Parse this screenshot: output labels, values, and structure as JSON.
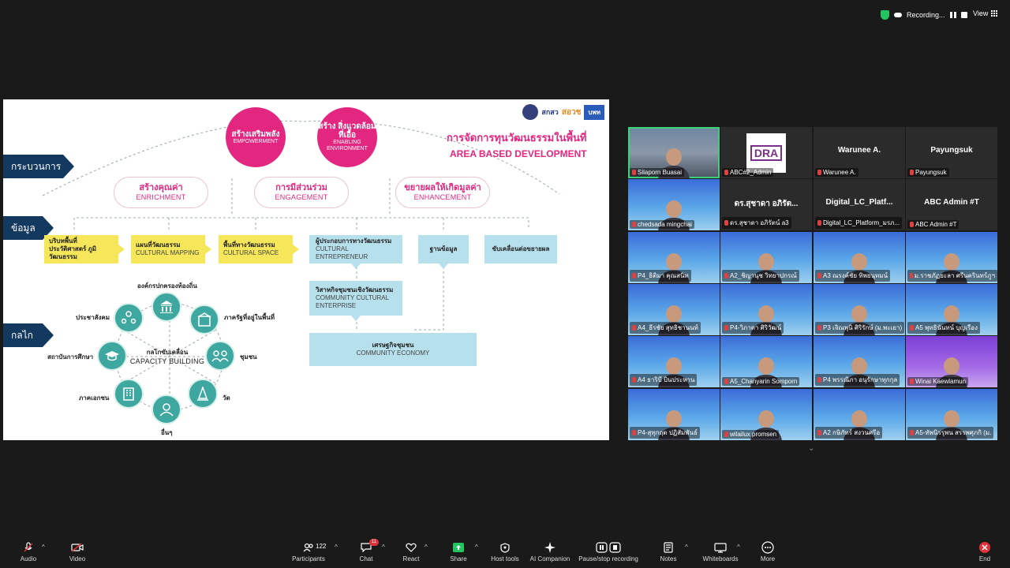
{
  "status_bar": {
    "recording_label": "Recording...",
    "view_label": "View"
  },
  "slide": {
    "title_th": "การจัดการทุนวัฒนธรรมในพื้นที่",
    "title_en": "AREA BASED DEVELOPMENT",
    "logo_texts": {
      "t": "สกสว",
      "s": "สอวช",
      "b": "บพท"
    },
    "circles": [
      {
        "th": "สร้างเสริมพลัง",
        "en": "EMPOWERMENT"
      },
      {
        "th": "สร้าง สิ่งแวดล้อมที่เอื้อ",
        "en": "ENABLING ENVIRONMENT"
      }
    ],
    "side_labels": {
      "process": "กระบวนการ",
      "data": "ข้อมูล",
      "mechanism": "กลไก"
    },
    "pills": [
      {
        "th": "สร้างคุณค่า",
        "en": "ENRICHMENT"
      },
      {
        "th": "การมีส่วนร่วม",
        "en": "ENGAGEMENT"
      },
      {
        "th": "ขยายผลให้เกิดมูลค่า",
        "en": "ENHANCEMENT"
      }
    ],
    "yellow_boxes": [
      {
        "th": "บริบทพื้นที่ประวัติศาสตร์ ภูมิวัฒนธรรม",
        "en": ""
      },
      {
        "th": "แผนที่วัฒนธรรม",
        "en": "CULTURAL MAPPING"
      },
      {
        "th": "พื้นที่ทางวัฒนธรรม",
        "en": "CULTURAL SPACE"
      }
    ],
    "blue_boxes": {
      "entrepreneur": {
        "th": "ผู้ประกอบการทางวัฒนธรรม",
        "en": "CULTURAL ENTREPRENEUR"
      },
      "database": {
        "th": "ฐานข้อมูล",
        "en": ""
      },
      "drive": {
        "th": "ขับเคลื่อนต่อขยายผล",
        "en": ""
      },
      "enterprise": {
        "th": "วิสาหกิจชุมชนเชิงวัฒนธรรม",
        "en": "COMMUNITY CULTURAL ENTERPRISE"
      },
      "economy": {
        "th": "เศรษฐกิจชุมชน",
        "en": "COMMUNITY ECONOMY"
      }
    },
    "capacity": {
      "th": "กลไกขับเคลื่อน",
      "en": "CAPACITY BUILDING"
    },
    "actors": {
      "local_gov": "องค์กรปกครองท้องถิ่น",
      "civil": "ประชาสังคม",
      "local_sector": "ภาครัฐที่อยู่ในพื้นที่",
      "education": "สถาบันการศึกษา",
      "community": "ชุมชน",
      "private": "ภาคเอกชน",
      "temple": "วัด",
      "others": "อื่นๆ"
    }
  },
  "participants": [
    {
      "name": "Silaporn Buasai",
      "kind": "video"
    },
    {
      "name": "ABC#2_Admin",
      "kind": "logo",
      "logo": "DRA"
    },
    {
      "name": "Warunee A.",
      "kind": "name",
      "big": "Warunee A."
    },
    {
      "name": "Payungsuk",
      "kind": "name",
      "big": "Payungsuk"
    },
    {
      "name": "chedsada mingchai",
      "kind": "abc"
    },
    {
      "name": "ดร.สุชาดา อภิรัตน์ a3",
      "kind": "name",
      "big": "ดร.สุชาดา อภิรัต..."
    },
    {
      "name": "Digital_LC_Platform_มรภ...",
      "kind": "name",
      "big": "Digital_LC_Platf..."
    },
    {
      "name": "ABC Admin #T",
      "kind": "name",
      "big": "ABC Admin #T"
    },
    {
      "name": "P4_ธิติมา คุณสนิท",
      "kind": "abc"
    },
    {
      "name": "A2_ชิญานุช วิทยาปกรณ์",
      "kind": "abc"
    },
    {
      "name": "A3 ณรงค์ชัย ทิพยนุทมน์",
      "kind": "abc"
    },
    {
      "name": "ม.ราชภัฏยะลา ศรีนครินทร์ภูฯ",
      "kind": "abc"
    },
    {
      "name": "A4_ธีรชัย สุทธิชานนท์",
      "kind": "abc"
    },
    {
      "name": "P4-วิภาดา ศิริวัฒน์",
      "kind": "abc"
    },
    {
      "name": "P3 เจิณพุนิ ศิริรักษ์ (ม.พะเยา)",
      "kind": "abc"
    },
    {
      "name": "A5 พุทธินันทน์ บุญเรือง",
      "kind": "abc"
    },
    {
      "name": "A4 ธาริบี บินประหาน",
      "kind": "abc"
    },
    {
      "name": "A5_Chanyarin Somporn",
      "kind": "dark"
    },
    {
      "name": "P4 พรรณิภา อนุรักษาทุกกุล",
      "kind": "abc"
    },
    {
      "name": "Winai Kaewlamun",
      "kind": "purple"
    },
    {
      "name": "P4-สุทุกฤต ปฏิสัมพันธ์",
      "kind": "abc"
    },
    {
      "name": "wilailux promsen",
      "kind": "abc"
    },
    {
      "name": "A2 กษิภัทร์ สงวนศรีอ",
      "kind": "abc"
    },
    {
      "name": "A5-ทัพนิรรุพน สรรพศุภกิ (ม.",
      "kind": "abc"
    }
  ],
  "toolbar": {
    "audio": "Audio",
    "video": "Video",
    "participants": "Participants",
    "participants_count": "122",
    "chat": "Chat",
    "chat_badge": "11",
    "react": "React",
    "share": "Share",
    "host_tools": "Host tools",
    "ai_companion": "AI Companion",
    "pause_stop": "Pause/stop recording",
    "notes": "Notes",
    "whiteboards": "Whiteboards",
    "more": "More",
    "end": "End"
  }
}
